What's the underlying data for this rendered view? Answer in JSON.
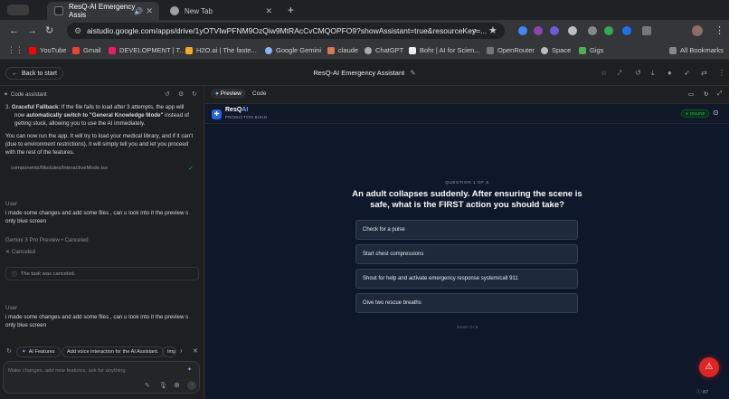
{
  "browser": {
    "tabs": [
      {
        "title": "ResQ-AI Emergency Assis",
        "active": true
      },
      {
        "title": "New Tab",
        "active": false
      }
    ],
    "url": "aistudio.google.com/apps/drive/1yOTVIwPFNM9OzQiw9MtRAcCvCMQOPFO9?showAssistant=true&resourceKey=...",
    "bookmarks": [
      "YouTube",
      "Gmail",
      "DEVELOPMENT | T...",
      "H2O.ai | The faste...",
      "Google Gemini",
      "claude",
      "ChatGPT",
      "Bohr | AI for Scien...",
      "OpenRouter",
      "Space",
      "Gigs"
    ],
    "all_bookmarks": "All Bookmarks"
  },
  "app": {
    "back_label": "Back to start",
    "title": "ResQ-AI Emergency Assistant"
  },
  "assistant": {
    "header": "Code assistant",
    "msg1_bold1": "Graceful Fallback",
    "msg1_line1": ": If the file fails to load after 3 attempts, the app will",
    "msg1_line2_pre": "now ",
    "msg1_bold2": "automatically switch to \"General Knowledge Mode\"",
    "msg1_line2_post": " instead of",
    "msg1_line3": "getting stuck, allowing you to use the AI immediately.",
    "msg2_line1": "You can now run the app. It will try to load your medical library, and if it can't",
    "msg2_line2": "(due to environment restrictions), it will simply tell you and let you proceed",
    "msg2_line3": "with the rest of the features.",
    "file_path": "components/Modules/InteractiveMode.tsx",
    "user_label": "User",
    "user_msg_line1": "i made some changes and add some files , can u look into it the preview s",
    "user_msg_line2": "only blue screen",
    "model_label": "Gemini 3 Pro Preview",
    "model_status": "Canceled",
    "canceled_label": "Canceled",
    "task_canceled": "The task was canceled.",
    "user_label2": "User",
    "user_msg2_line1": "i made some changes and add some files , can u look into it the preview s",
    "user_msg2_line2": "only blue screen",
    "chips": [
      "AI Features",
      "Add voice interaction for the AI Assistant.",
      "Imp"
    ],
    "composer_placeholder": "Make changes, add new features, ask for anything"
  },
  "preview": {
    "tab_preview": "Preview",
    "tab_code": "Code",
    "brand_a": "ResQ",
    "brand_b": "AI",
    "brand_sub": "PRODUCTION BUILD",
    "status": "ONLINE",
    "question_counter": "QUESTION 1 OF 5",
    "question_line1": "An adult collapses suddenly. After ensuring the scene is",
    "question_line2": "safe, what is the FIRST action you should take?",
    "options": [
      "Check for a pulse",
      "Start chest compressions",
      "Shout for help and activate emergency response system/call 911",
      "Give two rescue breaths"
    ],
    "score": "Score: 0 / 5",
    "footer_count": "87"
  },
  "colors": {
    "accent_blue": "#3b82f6",
    "sos_red": "#dc2626",
    "online_green": "#22c55e"
  }
}
